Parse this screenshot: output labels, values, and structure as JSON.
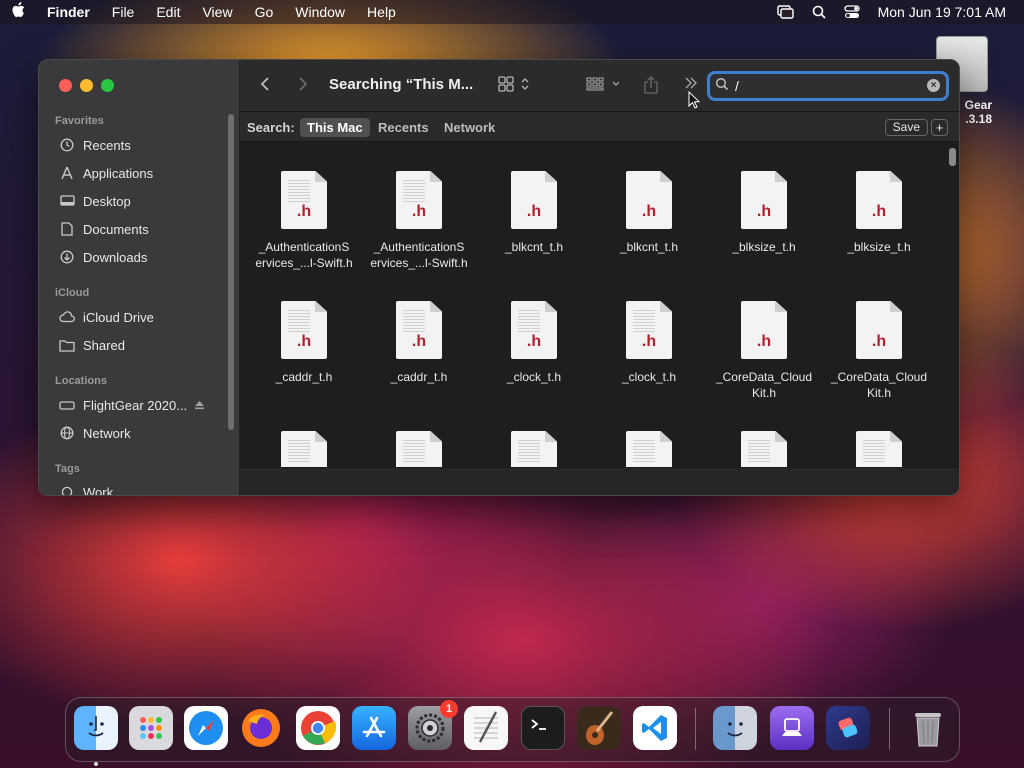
{
  "menubar": {
    "app_name": "Finder",
    "menus": [
      "File",
      "Edit",
      "View",
      "Go",
      "Window",
      "Help"
    ],
    "clock": "Mon Jun 19  7:01 AM",
    "status_icons": [
      "screen-mirroring-icon",
      "spotlight-search-icon",
      "control-center-icon"
    ]
  },
  "desktop_icon": {
    "label_line1": "Gear",
    "label_line2": ".3.18"
  },
  "window": {
    "title": "Searching “This M...",
    "sidebar": {
      "favorites_header": "Favorites",
      "favorites": [
        {
          "label": "Recents",
          "icon": "clock-icon"
        },
        {
          "label": "Applications",
          "icon": "applications-icon"
        },
        {
          "label": "Desktop",
          "icon": "desktop-icon"
        },
        {
          "label": "Documents",
          "icon": "document-icon"
        },
        {
          "label": "Downloads",
          "icon": "download-icon"
        }
      ],
      "icloud_header": "iCloud",
      "icloud": [
        {
          "label": "iCloud Drive",
          "icon": "cloud-icon"
        },
        {
          "label": "Shared",
          "icon": "shared-folder-icon"
        }
      ],
      "locations_header": "Locations",
      "locations": [
        {
          "label": "FlightGear 2020...",
          "icon": "drive-icon"
        },
        {
          "label": "Network",
          "icon": "globe-icon"
        }
      ],
      "tags_header": "Tags",
      "tags": [
        {
          "label": "Work",
          "icon": "tag-icon"
        }
      ]
    },
    "search": {
      "value": "/",
      "placeholder": "Search"
    },
    "scope_bar": {
      "label": "Search:",
      "scopes": [
        "This Mac",
        "Recents",
        "Network"
      ],
      "active_scope": "This Mac",
      "save_label": "Save",
      "add_label": "+"
    },
    "files": [
      {
        "line1": "_AuthenticationS",
        "line2": "ervices_...l-Swift.h"
      },
      {
        "line1": "_AuthenticationS",
        "line2": "ervices_...l-Swift.h"
      },
      {
        "line1": "_blkcnt_t.h",
        "line2": ""
      },
      {
        "line1": "_blkcnt_t.h",
        "line2": ""
      },
      {
        "line1": "_blksize_t.h",
        "line2": ""
      },
      {
        "line1": "_blksize_t.h",
        "line2": ""
      },
      {
        "line1": "_caddr_t.h",
        "line2": ""
      },
      {
        "line1": "_caddr_t.h",
        "line2": ""
      },
      {
        "line1": "_clock_t.h",
        "line2": ""
      },
      {
        "line1": "_clock_t.h",
        "line2": ""
      },
      {
        "line1": "_CoreData_Cloud",
        "line2": "Kit.h"
      },
      {
        "line1": "_CoreData_Cloud",
        "line2": "Kit.h"
      }
    ],
    "file_ext": ".h"
  },
  "dock": {
    "items": [
      {
        "name": "finder-icon",
        "color": "#2f8cf0"
      },
      {
        "name": "launchpad-icon",
        "color": "#dcdcdc"
      },
      {
        "name": "safari-icon",
        "color": "#2a92e8"
      },
      {
        "name": "firefox-icon",
        "color": "#ff7a1a"
      },
      {
        "name": "chrome-icon",
        "color": "#ffffff"
      },
      {
        "name": "app-store-icon",
        "color": "#1a8cf0"
      },
      {
        "name": "system-settings-icon",
        "color": "#8e8e93"
      },
      {
        "name": "textedit-icon",
        "color": "#f5f5f5"
      },
      {
        "name": "terminal-icon",
        "color": "#1c1c1c"
      },
      {
        "name": "garageband-icon",
        "color": "#3a2a1c"
      },
      {
        "name": "vscode-icon",
        "color": "#ffffff"
      },
      {
        "name": "finder-icon",
        "color": "#8ab4e8"
      },
      {
        "name": "podcasts-icon",
        "color": "#7b4fd6"
      },
      {
        "name": "shortcuts-icon",
        "color": "#5a3bd0"
      },
      {
        "name": "trash-icon",
        "color": "#9a9a9a"
      }
    ],
    "settings_badge": "1"
  }
}
